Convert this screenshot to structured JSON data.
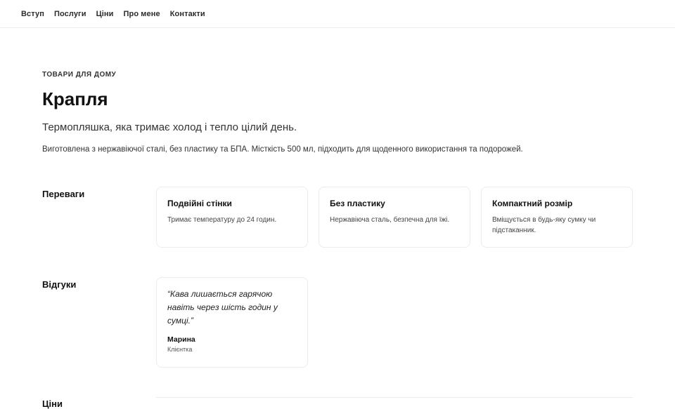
{
  "nav": {
    "items": [
      "Вступ",
      "Послуги",
      "Ціни",
      "Про мене",
      "Контакти"
    ]
  },
  "hero": {
    "eyebrow": "ТОВАРИ ДЛЯ ДОМУ",
    "title": "Крапля",
    "subtitle": "Термопляшка, яка тримає холод і тепло цілий день.",
    "description": "Виготовлена з нержавіючої сталі, без пластику та БПА. Місткість 500 мл, підходить для щоденного використання та подорожей."
  },
  "benefits": {
    "label": "Переваги",
    "cards": [
      {
        "title": "Подвійні стінки",
        "text": "Тримає температуру до 24 годин."
      },
      {
        "title": "Без пластику",
        "text": "Нержавіюча сталь, безпечна для їжі."
      },
      {
        "title": "Компактний розмір",
        "text": "Вміщується в будь-яку сумку чи підстаканник."
      }
    ]
  },
  "reviews": {
    "label": "Відгуки",
    "items": [
      {
        "quote": "“Кава лишається гарячою навіть через шість годин у сумці.”",
        "author": "Марина",
        "role": "Клієнтка"
      }
    ]
  },
  "prices": {
    "label": "Ціни"
  }
}
